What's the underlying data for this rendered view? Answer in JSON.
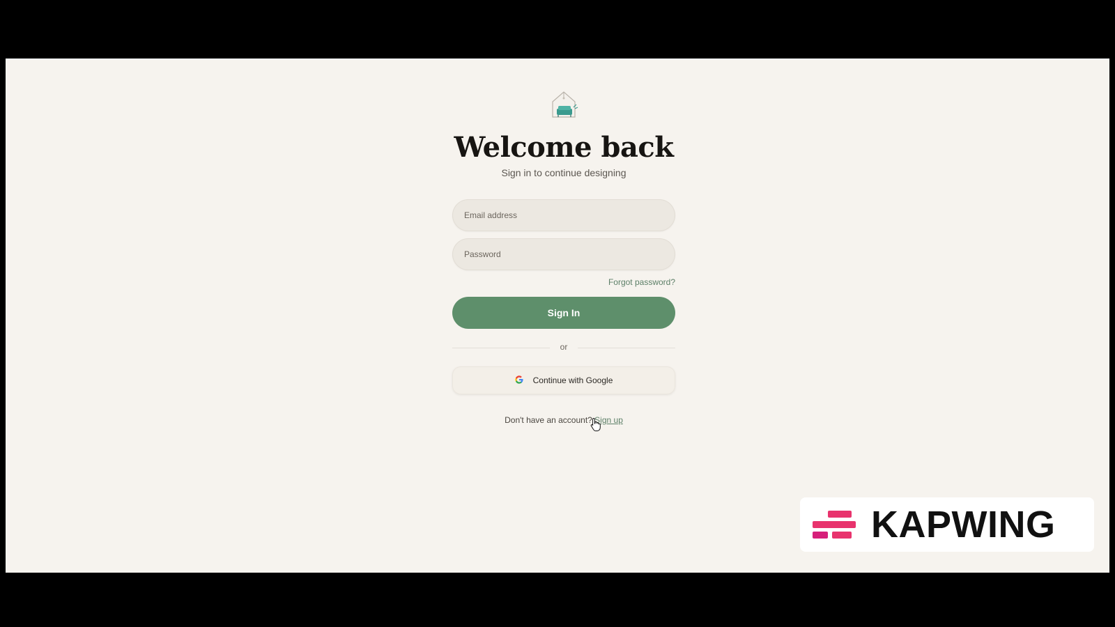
{
  "auth": {
    "title": "Welcome back",
    "subtitle": "Sign in to continue designing",
    "email_placeholder": "Email address",
    "password_placeholder": "Password",
    "forgot_label": "Forgot password?",
    "signin_label": "Sign In",
    "divider_label": "or",
    "google_label": "Continue with Google",
    "signup_prompt": "Don't have an account?",
    "signup_label": "Sign up"
  },
  "watermark": {
    "text": "KAPWING"
  },
  "icons": {
    "logo": "house-with-sofa-icon",
    "google": "google-icon",
    "cursor": "hand-pointer-cursor"
  },
  "colors": {
    "background": "#f6f3ee",
    "accent": "#5e8f6b",
    "link": "#5c7f67",
    "field": "#ece8e1",
    "brand_magenta": "#e8336d"
  }
}
